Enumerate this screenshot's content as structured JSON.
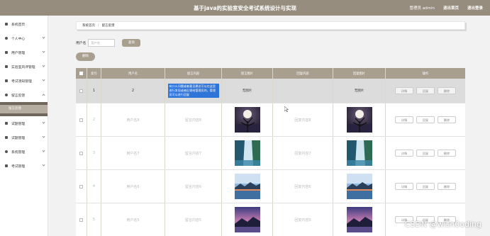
{
  "header": {
    "title": "基于java的实验室安全考试系统设计与实现",
    "admin_label": "管理员 admin",
    "home_link": "退出首页",
    "logout_link": "退出登录"
  },
  "sidebar": {
    "items": [
      {
        "label": "系统首页",
        "icon": "home-icon"
      },
      {
        "label": "个人中心",
        "icon": "user-icon"
      },
      {
        "label": "用户管理",
        "icon": "users-icon"
      },
      {
        "label": "实验室风评管理",
        "icon": "grid-icon"
      },
      {
        "label": "考试须知管理",
        "icon": "flag-icon"
      },
      {
        "label": "留言反馈",
        "icon": "message-icon",
        "sub": "留言反馈"
      },
      {
        "label": "试题管理",
        "icon": "list-icon"
      },
      {
        "label": "试题管理",
        "icon": "list-icon"
      },
      {
        "label": "系统管理",
        "icon": "system-icon"
      },
      {
        "label": "考试管理",
        "icon": "exam-icon"
      }
    ]
  },
  "breadcrumb": {
    "home": "系统首页",
    "current": "留言反馈"
  },
  "search": {
    "label": "用户名",
    "placeholder": "用户名",
    "button": "查询"
  },
  "delete_button": "删除",
  "table": {
    "headers": [
      "",
      "索引",
      "用户名",
      "留言内容",
      "留言图片",
      "回复内容",
      "回复图片",
      "操作"
    ],
    "row1": {
      "index": "1",
      "username": "2",
      "content": "有什么问题或者意见建议可以在这里进行发现或者反馈给管理员的，管理员可以进行回复",
      "qimg": "无图片",
      "reply": "",
      "aimg": "无图片"
    },
    "rows": [
      {
        "index": "2",
        "username": "用户名8",
        "content": "留言内容8",
        "reply": "回复内容8",
        "img": "moon"
      },
      {
        "index": "3",
        "username": "用户名7",
        "content": "留言内容7",
        "reply": "回复内容7",
        "img": "waterfall"
      },
      {
        "index": "4",
        "username": "用户名6",
        "content": "留言内容6",
        "reply": "回复内容6",
        "img": "lake"
      },
      {
        "index": "5",
        "username": "用户名5",
        "content": "留言内容5",
        "reply": "回复内容5",
        "img": "sunset"
      }
    ],
    "actions": [
      "详情",
      "回复",
      "删除"
    ]
  },
  "watermark": "CSDN @wish0oding",
  "colors": {
    "topbar": "#968d7f",
    "accent": "#a89f8f",
    "selection": "#2f74d8"
  }
}
